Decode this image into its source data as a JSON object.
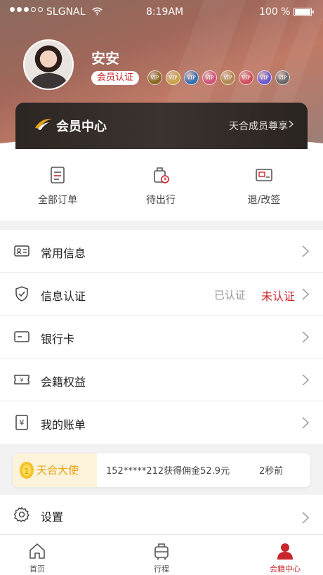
{
  "status_bar": {
    "carrier": "SLGNAL",
    "time": "8:19AM",
    "battery": "100 %"
  },
  "profile": {
    "name": "安安",
    "badge": "会员认证",
    "vip_badges": [
      {
        "label": "VIP",
        "color": "#8a6a22"
      },
      {
        "label": "VIP",
        "color": "#c9a24a"
      },
      {
        "label": "VIP",
        "color": "#3c6fb5"
      },
      {
        "label": "VIP",
        "color": "#d0567a"
      },
      {
        "label": "VIP",
        "color": "#b28a52"
      },
      {
        "label": "VIP",
        "color": "#cf4e5c"
      },
      {
        "label": "VIP",
        "color": "#6f5ad0"
      },
      {
        "label": "VIP",
        "color": "#6b6b6b"
      }
    ]
  },
  "member_card": {
    "title": "会员中心",
    "link": "天合成员尊享"
  },
  "orders": [
    {
      "label": "全部订单",
      "icon": "order-list-icon"
    },
    {
      "label": "待出行",
      "icon": "luggage-clock-icon"
    },
    {
      "label": "退/改签",
      "icon": "ticket-refund-icon"
    }
  ],
  "menu": [
    {
      "label": "常用信息",
      "icon": "id-card-icon"
    },
    {
      "label": "信息认证",
      "icon": "shield-check-icon",
      "status_done": "已认证",
      "status_pending": "未认证"
    },
    {
      "label": "银行卡",
      "icon": "bank-card-icon"
    },
    {
      "label": "会籍权益",
      "icon": "membership-ticket-icon"
    },
    {
      "label": "我的账单",
      "icon": "bill-icon"
    }
  ],
  "ambassador": {
    "tag": "天合大使",
    "message": "152*****212获得佣金52.9元",
    "time": "2秒前"
  },
  "settings": {
    "label": "设置"
  },
  "tabs": [
    {
      "label": "首页",
      "icon": "home-icon"
    },
    {
      "label": "行程",
      "icon": "luggage-icon"
    },
    {
      "label": "会籍中心",
      "icon": "user-icon",
      "active": true
    }
  ],
  "colors": {
    "accent": "#c8252c",
    "gold": "#e7a115"
  }
}
